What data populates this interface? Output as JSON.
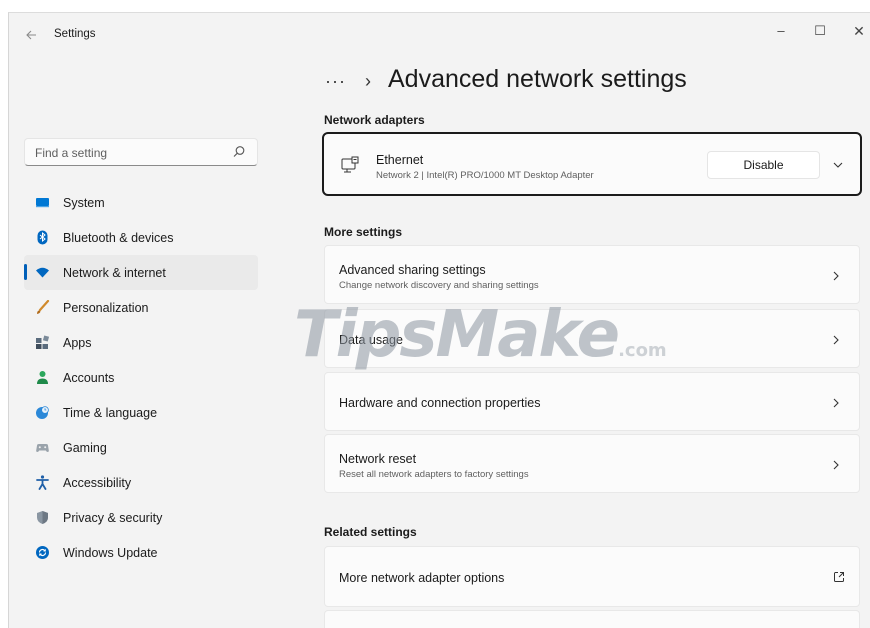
{
  "window": {
    "app_title": "Settings",
    "back_icon": "arrow-left-icon",
    "controls": {
      "minimize": "–",
      "maximize": "☐",
      "close": "✕"
    }
  },
  "sidebar": {
    "search": {
      "placeholder": "Find a setting",
      "icon": "search-icon"
    },
    "items": [
      {
        "label": "System",
        "icon": "monitor-icon",
        "color": "#0078d4",
        "active": false
      },
      {
        "label": "Bluetooth & devices",
        "icon": "bluetooth-icon",
        "color": "#0067c0",
        "active": false
      },
      {
        "label": "Network & internet",
        "icon": "wifi-icon",
        "color": "#0067c0",
        "active": true
      },
      {
        "label": "Personalization",
        "icon": "brush-icon",
        "color": "#d08a2c",
        "active": false
      },
      {
        "label": "Apps",
        "icon": "apps-icon",
        "color": "#5a6b7d",
        "active": false
      },
      {
        "label": "Accounts",
        "icon": "person-icon",
        "color": "#2aa65b",
        "active": false
      },
      {
        "label": "Time & language",
        "icon": "globe-clock-icon",
        "color": "#2b88d8",
        "active": false
      },
      {
        "label": "Gaming",
        "icon": "gamepad-icon",
        "color": "#8a8a8a",
        "active": false
      },
      {
        "label": "Accessibility",
        "icon": "accessibility-icon",
        "color": "#1f5fa8",
        "active": false
      },
      {
        "label": "Privacy & security",
        "icon": "shield-icon",
        "color": "#7d8a96",
        "active": false
      },
      {
        "label": "Windows Update",
        "icon": "update-icon",
        "color": "#0067c0",
        "active": false
      }
    ]
  },
  "main": {
    "breadcrumb": {
      "dots": "···",
      "separator": "›"
    },
    "page_title": "Advanced network settings",
    "adapters_section": {
      "title": "Network adapters",
      "adapter": {
        "name": "Ethernet",
        "description": "Network 2 | Intel(R) PRO/1000 MT Desktop Adapter",
        "button_label": "Disable"
      }
    },
    "more_settings": {
      "title": "More settings",
      "items": [
        {
          "title": "Advanced sharing settings",
          "subtitle": "Change network discovery and sharing settings"
        },
        {
          "title": "Data usage",
          "subtitle": ""
        },
        {
          "title": "Hardware and connection properties",
          "subtitle": ""
        },
        {
          "title": "Network reset",
          "subtitle": "Reset all network adapters to factory settings"
        }
      ]
    },
    "related_settings": {
      "title": "Related settings",
      "items": [
        {
          "title": "More network adapter options",
          "icon": "open-external-icon"
        }
      ]
    }
  },
  "watermark": {
    "text": "TipsMake",
    "suffix": ".com"
  },
  "colors": {
    "accent": "#005fb8",
    "window_bg": "#f3f3f3",
    "card_bg": "#fbfbfb"
  }
}
